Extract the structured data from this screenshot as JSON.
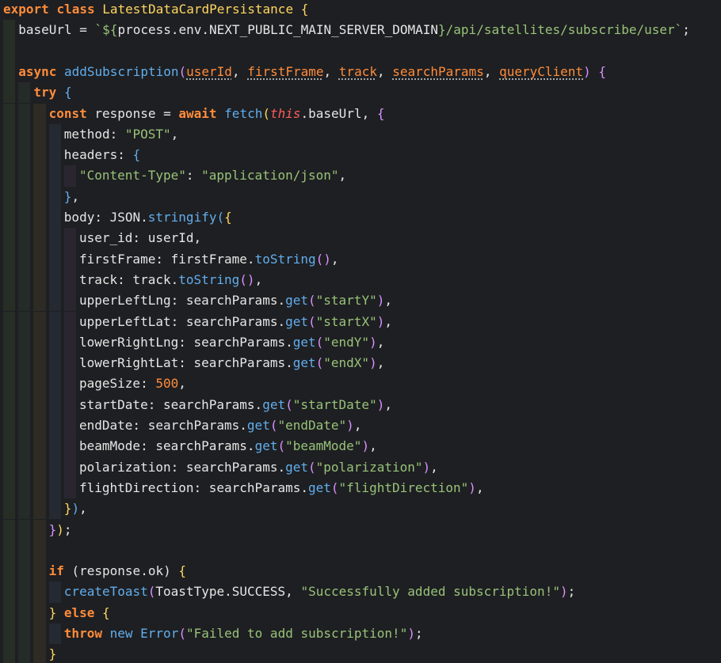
{
  "editor": {
    "theme": {
      "background": "#1e1f22",
      "keyword": "#ff8c3a",
      "class_name": "#ffd75f",
      "function": "#61aeee",
      "string": "#98c379",
      "this": "#ff5d5d",
      "text": "#e6e6e6"
    },
    "lines": [
      {
        "indent": 0,
        "tokens": [
          {
            "t": "export",
            "k": "keyword"
          },
          {
            "t": " ",
            "k": "default"
          },
          {
            "t": "class",
            "k": "keyword"
          },
          {
            "t": " ",
            "k": "default"
          },
          {
            "t": "LatestDataCardPersistance",
            "k": "class"
          },
          {
            "t": " ",
            "k": "default"
          },
          {
            "t": "{",
            "k": "bracket1"
          }
        ]
      },
      {
        "indent": 1,
        "tokens": [
          {
            "t": "baseUrl",
            "k": "prop"
          },
          {
            "t": " = ",
            "k": "default"
          },
          {
            "t": "`${",
            "k": "template"
          },
          {
            "t": "process.env.NEXT_PUBLIC_MAIN_SERVER_DOMAIN",
            "k": "default"
          },
          {
            "t": "}",
            "k": "template"
          },
          {
            "t": "/api/satellites/subscribe/user`",
            "k": "template"
          },
          {
            "t": ";",
            "k": "default"
          }
        ]
      },
      {
        "indent": 1,
        "tokens": []
      },
      {
        "indent": 1,
        "tokens": [
          {
            "t": "async",
            "k": "keyword"
          },
          {
            "t": " ",
            "k": "default"
          },
          {
            "t": "addSubscription",
            "k": "func"
          },
          {
            "t": "(",
            "k": "bracket2"
          },
          {
            "t": "userId",
            "k": "param"
          },
          {
            "t": ", ",
            "k": "default"
          },
          {
            "t": "firstFrame",
            "k": "param"
          },
          {
            "t": ", ",
            "k": "default"
          },
          {
            "t": "track",
            "k": "param"
          },
          {
            "t": ", ",
            "k": "default"
          },
          {
            "t": "searchParams",
            "k": "param"
          },
          {
            "t": ", ",
            "k": "default"
          },
          {
            "t": "queryClient",
            "k": "param"
          },
          {
            "t": ")",
            "k": "bracket2"
          },
          {
            "t": " ",
            "k": "default"
          },
          {
            "t": "{",
            "k": "bracket2"
          }
        ]
      },
      {
        "indent": 2,
        "tokens": [
          {
            "t": "try",
            "k": "keyword"
          },
          {
            "t": " ",
            "k": "default"
          },
          {
            "t": "{",
            "k": "bracket3"
          }
        ]
      },
      {
        "indent": 3,
        "tokens": [
          {
            "t": "const",
            "k": "keyword"
          },
          {
            "t": " response = ",
            "k": "default"
          },
          {
            "t": "await",
            "k": "keyword"
          },
          {
            "t": " ",
            "k": "default"
          },
          {
            "t": "fetch",
            "k": "func"
          },
          {
            "t": "(",
            "k": "bracket1"
          },
          {
            "t": "this",
            "k": "thiskw"
          },
          {
            "t": ".baseUrl, ",
            "k": "default"
          },
          {
            "t": "{",
            "k": "bracket2"
          }
        ]
      },
      {
        "indent": 4,
        "tokens": [
          {
            "t": "method: ",
            "k": "default"
          },
          {
            "t": "\"POST\"",
            "k": "string"
          },
          {
            "t": ",",
            "k": "default"
          }
        ]
      },
      {
        "indent": 4,
        "tokens": [
          {
            "t": "headers: ",
            "k": "default"
          },
          {
            "t": "{",
            "k": "bracket3"
          }
        ]
      },
      {
        "indent": 5,
        "tokens": [
          {
            "t": "\"Content-Type\"",
            "k": "string"
          },
          {
            "t": ": ",
            "k": "default"
          },
          {
            "t": "\"application/json\"",
            "k": "string"
          },
          {
            "t": ",",
            "k": "default"
          }
        ]
      },
      {
        "indent": 4,
        "tokens": [
          {
            "t": "}",
            "k": "bracket3"
          },
          {
            "t": ",",
            "k": "default"
          }
        ]
      },
      {
        "indent": 4,
        "tokens": [
          {
            "t": "body: JSON.",
            "k": "default"
          },
          {
            "t": "stringify",
            "k": "func"
          },
          {
            "t": "(",
            "k": "bracket3"
          },
          {
            "t": "{",
            "k": "bracket1"
          }
        ]
      },
      {
        "indent": 5,
        "tokens": [
          {
            "t": "user_id: userId,",
            "k": "default"
          }
        ]
      },
      {
        "indent": 5,
        "tokens": [
          {
            "t": "firstFrame: firstFrame.",
            "k": "default"
          },
          {
            "t": "toString",
            "k": "func"
          },
          {
            "t": "()",
            "k": "bracket2"
          },
          {
            "t": ",",
            "k": "default"
          }
        ]
      },
      {
        "indent": 5,
        "tokens": [
          {
            "t": "track: track.",
            "k": "default"
          },
          {
            "t": "toString",
            "k": "func"
          },
          {
            "t": "()",
            "k": "bracket2"
          },
          {
            "t": ",",
            "k": "default"
          }
        ]
      },
      {
        "indent": 5,
        "tokens": [
          {
            "t": "upperLeftLng: searchParams.",
            "k": "default"
          },
          {
            "t": "get",
            "k": "func"
          },
          {
            "t": "(",
            "k": "bracket2"
          },
          {
            "t": "\"startY\"",
            "k": "string"
          },
          {
            "t": ")",
            "k": "bracket2"
          },
          {
            "t": ",",
            "k": "default"
          }
        ]
      },
      {
        "indent": 5,
        "tokens": [
          {
            "t": "upperLeftLat: searchParams.",
            "k": "default"
          },
          {
            "t": "get",
            "k": "func"
          },
          {
            "t": "(",
            "k": "bracket2"
          },
          {
            "t": "\"startX\"",
            "k": "string"
          },
          {
            "t": ")",
            "k": "bracket2"
          },
          {
            "t": ",",
            "k": "default"
          }
        ]
      },
      {
        "indent": 5,
        "tokens": [
          {
            "t": "lowerRightLng: searchParams.",
            "k": "default"
          },
          {
            "t": "get",
            "k": "func"
          },
          {
            "t": "(",
            "k": "bracket2"
          },
          {
            "t": "\"endY\"",
            "k": "string"
          },
          {
            "t": ")",
            "k": "bracket2"
          },
          {
            "t": ",",
            "k": "default"
          }
        ]
      },
      {
        "indent": 5,
        "tokens": [
          {
            "t": "lowerRightLat: searchParams.",
            "k": "default"
          },
          {
            "t": "get",
            "k": "func"
          },
          {
            "t": "(",
            "k": "bracket2"
          },
          {
            "t": "\"endX\"",
            "k": "string"
          },
          {
            "t": ")",
            "k": "bracket2"
          },
          {
            "t": ",",
            "k": "default"
          }
        ]
      },
      {
        "indent": 5,
        "tokens": [
          {
            "t": "pageSize: ",
            "k": "default"
          },
          {
            "t": "500",
            "k": "number"
          },
          {
            "t": ",",
            "k": "default"
          }
        ]
      },
      {
        "indent": 5,
        "tokens": [
          {
            "t": "startDate: searchParams.",
            "k": "default"
          },
          {
            "t": "get",
            "k": "func"
          },
          {
            "t": "(",
            "k": "bracket2"
          },
          {
            "t": "\"startDate\"",
            "k": "string"
          },
          {
            "t": ")",
            "k": "bracket2"
          },
          {
            "t": ",",
            "k": "default"
          }
        ]
      },
      {
        "indent": 5,
        "tokens": [
          {
            "t": "endDate: searchParams.",
            "k": "default"
          },
          {
            "t": "get",
            "k": "func"
          },
          {
            "t": "(",
            "k": "bracket2"
          },
          {
            "t": "\"endDate\"",
            "k": "string"
          },
          {
            "t": ")",
            "k": "bracket2"
          },
          {
            "t": ",",
            "k": "default"
          }
        ]
      },
      {
        "indent": 5,
        "tokens": [
          {
            "t": "beamMode: searchParams.",
            "k": "default"
          },
          {
            "t": "get",
            "k": "func"
          },
          {
            "t": "(",
            "k": "bracket2"
          },
          {
            "t": "\"beamMode\"",
            "k": "string"
          },
          {
            "t": ")",
            "k": "bracket2"
          },
          {
            "t": ",",
            "k": "default"
          }
        ]
      },
      {
        "indent": 5,
        "tokens": [
          {
            "t": "polarization: searchParams.",
            "k": "default"
          },
          {
            "t": "get",
            "k": "func"
          },
          {
            "t": "(",
            "k": "bracket2"
          },
          {
            "t": "\"polarization\"",
            "k": "string"
          },
          {
            "t": ")",
            "k": "bracket2"
          },
          {
            "t": ",",
            "k": "default"
          }
        ]
      },
      {
        "indent": 5,
        "tokens": [
          {
            "t": "flightDirection: searchParams.",
            "k": "default"
          },
          {
            "t": "get",
            "k": "func"
          },
          {
            "t": "(",
            "k": "bracket2"
          },
          {
            "t": "\"flightDirection\"",
            "k": "string"
          },
          {
            "t": ")",
            "k": "bracket2"
          },
          {
            "t": ",",
            "k": "default"
          }
        ]
      },
      {
        "indent": 4,
        "tokens": [
          {
            "t": "}",
            "k": "bracket1"
          },
          {
            "t": ")",
            "k": "bracket3"
          },
          {
            "t": ",",
            "k": "default"
          }
        ]
      },
      {
        "indent": 3,
        "tokens": [
          {
            "t": "}",
            "k": "bracket2"
          },
          {
            "t": ")",
            "k": "bracket1"
          },
          {
            "t": ";",
            "k": "default"
          }
        ]
      },
      {
        "indent": 3,
        "tokens": []
      },
      {
        "indent": 3,
        "tokens": [
          {
            "t": "if",
            "k": "keyword"
          },
          {
            "t": " (response.ok) ",
            "k": "default"
          },
          {
            "t": "{",
            "k": "bracket1"
          }
        ]
      },
      {
        "indent": 4,
        "tokens": [
          {
            "t": "createToast",
            "k": "func"
          },
          {
            "t": "(",
            "k": "bracket2"
          },
          {
            "t": "ToastType.SUCCESS, ",
            "k": "default"
          },
          {
            "t": "\"Successfully added subscription!\"",
            "k": "string"
          },
          {
            "t": ")",
            "k": "bracket2"
          },
          {
            "t": ";",
            "k": "default"
          }
        ]
      },
      {
        "indent": 3,
        "tokens": [
          {
            "t": "}",
            "k": "bracket1"
          },
          {
            "t": " ",
            "k": "default"
          },
          {
            "t": "else",
            "k": "keyword"
          },
          {
            "t": " ",
            "k": "default"
          },
          {
            "t": "{",
            "k": "bracket1"
          }
        ]
      },
      {
        "indent": 4,
        "tokens": [
          {
            "t": "throw",
            "k": "keyword"
          },
          {
            "t": " ",
            "k": "default"
          },
          {
            "t": "new",
            "k": "func"
          },
          {
            "t": " ",
            "k": "default"
          },
          {
            "t": "Error",
            "k": "func"
          },
          {
            "t": "(",
            "k": "bracket2"
          },
          {
            "t": "\"Failed to add subscription!\"",
            "k": "string"
          },
          {
            "t": ")",
            "k": "bracket2"
          },
          {
            "t": ";",
            "k": "default"
          }
        ]
      },
      {
        "indent": 3,
        "tokens": [
          {
            "t": "}",
            "k": "bracket1"
          }
        ]
      }
    ]
  }
}
